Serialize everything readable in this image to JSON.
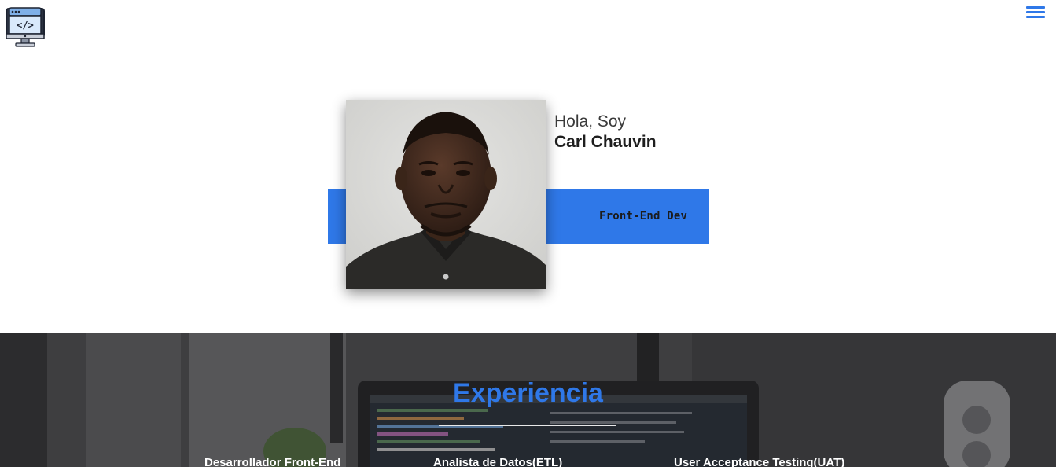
{
  "header": {
    "logo_icon": "code-monitor-icon",
    "menu_icon": "hamburger-menu-icon"
  },
  "hero": {
    "greeting": "Hola, Soy",
    "name": "Carl Chauvin",
    "role": "Front-End Dev",
    "accent_color": "#2f78e8"
  },
  "experience": {
    "title": "Experiencia",
    "items": [
      "Desarrollador Front-End",
      "Analista de Datos(ETL)",
      "User Acceptance Testing(UAT)"
    ]
  }
}
